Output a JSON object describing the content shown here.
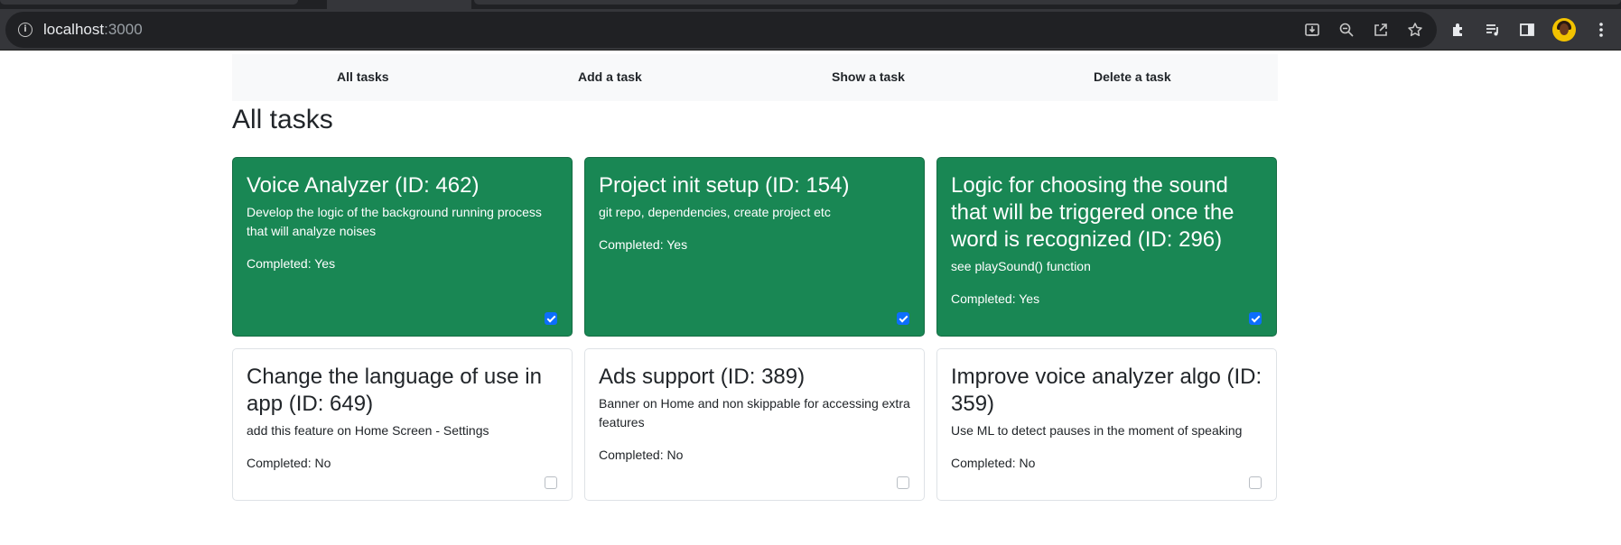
{
  "browser": {
    "url_host": "localhost",
    "url_port": ":3000",
    "omnibox_icons": [
      "install-app-icon",
      "zoom-out-icon",
      "share-icon",
      "bookmark-star-icon"
    ],
    "toolbar_icons": [
      "extensions-icon",
      "reading-list-icon",
      "side-panel-icon",
      "profile-avatar",
      "menu-kebab-icon"
    ]
  },
  "nav": {
    "items": [
      {
        "label": "All tasks"
      },
      {
        "label": "Add a task"
      },
      {
        "label": "Show a task"
      },
      {
        "label": "Delete a task"
      }
    ]
  },
  "page": {
    "title": "All tasks"
  },
  "tasks": [
    {
      "title": "Voice Analyzer (ID: 462)",
      "description": "Develop the logic of the background running process that will analyze noises",
      "completed_text": "Completed: Yes",
      "completed": true
    },
    {
      "title": "Project init setup (ID: 154)",
      "description": "git repo, dependencies, create project etc",
      "completed_text": "Completed: Yes",
      "completed": true
    },
    {
      "title": "Logic for choosing the sound that will be triggered once the word is recognized (ID: 296)",
      "description": "see playSound() function",
      "completed_text": "Completed: Yes",
      "completed": true
    },
    {
      "title": "Change the language of use in app (ID: 649)",
      "description": "add this feature on Home Screen - Settings",
      "completed_text": "Completed: No",
      "completed": false
    },
    {
      "title": "Ads support (ID: 389)",
      "description": "Banner on Home and non skippable for accessing extra features",
      "completed_text": "Completed: No",
      "completed": false
    },
    {
      "title": "Improve voice analyzer algo (ID: 359)",
      "description": "Use ML to detect pauses in the moment of speaking",
      "completed_text": "Completed: No",
      "completed": false
    }
  ],
  "colors": {
    "done_card": "#198754",
    "checkbox_checked": "#0d6efd",
    "nav_bg": "#f8f9fa"
  }
}
